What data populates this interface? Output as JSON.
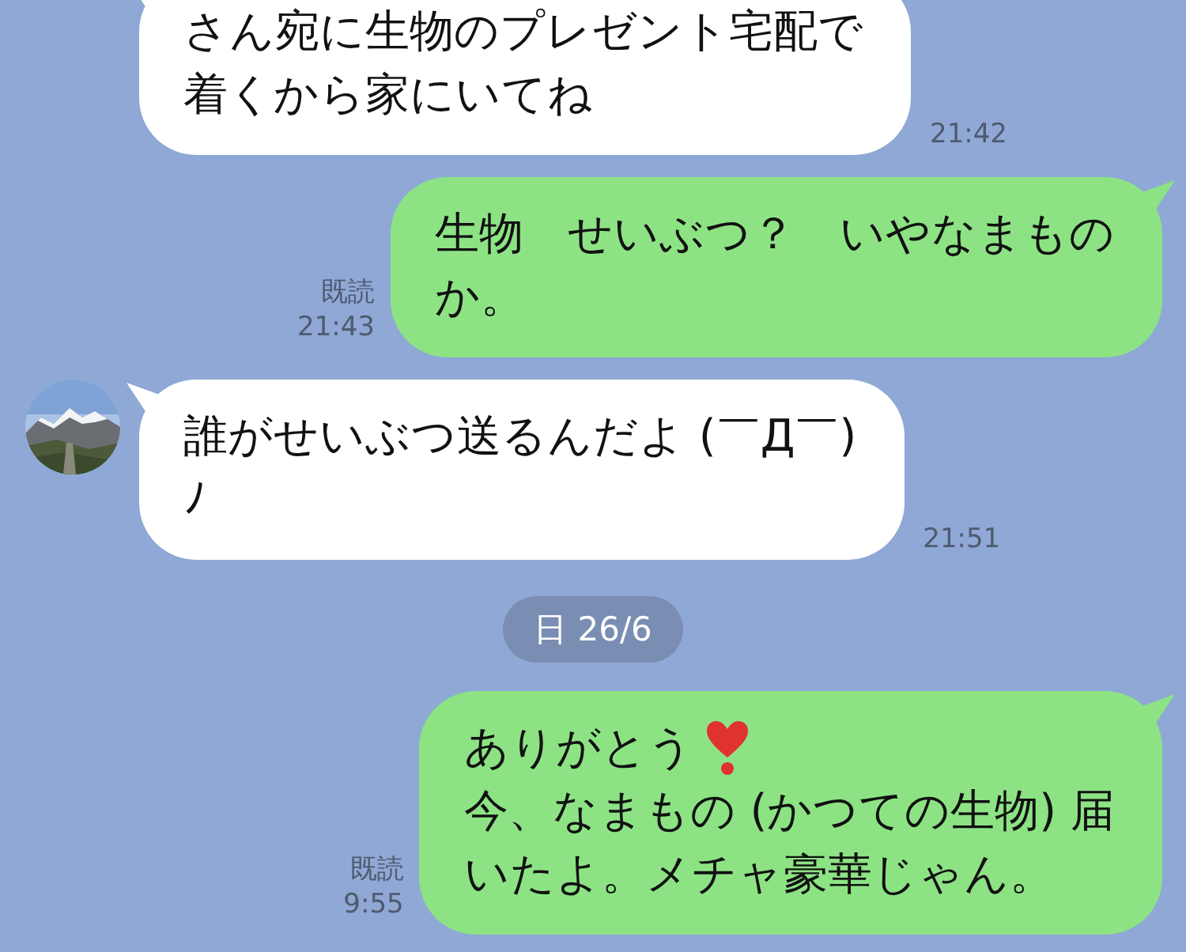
{
  "messages": [
    {
      "kind": "incoming",
      "lines": [
        {
          "text": "さん宛に生物のプレゼント宅配で"
        },
        {
          "text": "着くから家にいてね"
        }
      ],
      "time": "21:42"
    },
    {
      "kind": "outgoing",
      "read_label": "既読",
      "lines": [
        {
          "text": "生物　せいぶつ？　いやなまもの"
        },
        {
          "text": "か。"
        }
      ],
      "time": "21:43"
    },
    {
      "kind": "incoming",
      "avatar": true,
      "lines": [
        {
          "text": "誰がせいぶつ送るんだよ (￣Д￣)"
        },
        {
          "text": "ﾉ"
        }
      ],
      "time": "21:51"
    },
    {
      "kind": "date",
      "label": "日 26/6"
    },
    {
      "kind": "outgoing",
      "read_label": "既読",
      "lines": [
        {
          "text": "ありがとう",
          "heart": true
        },
        {
          "text": "今、なまもの (かつての生物) 届"
        },
        {
          "text": "いたよ。メチャ豪華じゃん。"
        }
      ],
      "time": "9:55"
    }
  ]
}
